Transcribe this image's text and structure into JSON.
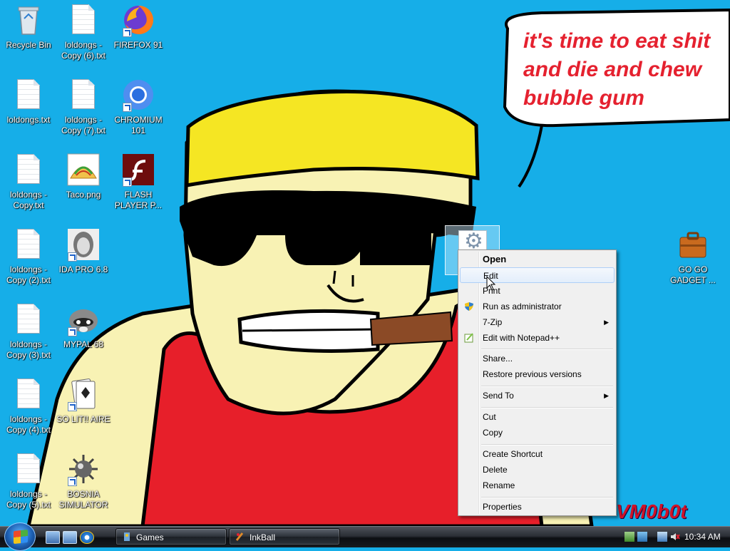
{
  "desktop": {
    "icons": [
      {
        "label": "Recycle Bin",
        "icon": "recycle-bin-icon"
      },
      {
        "label": "loldongs - Copy (6).txt",
        "icon": "text-file-icon"
      },
      {
        "label": "FIREFOX 91",
        "icon": "firefox-icon"
      },
      {
        "label": "loldongs.txt",
        "icon": "text-file-icon"
      },
      {
        "label": "loldongs - Copy (7).txt",
        "icon": "text-file-icon"
      },
      {
        "label": "CHROMIUM 101",
        "icon": "chromium-icon"
      },
      {
        "label": "loldongs - Copy.txt",
        "icon": "text-file-icon"
      },
      {
        "label": "Taco.png",
        "icon": "taco-image-icon"
      },
      {
        "label": "FLASH PLAYER P...",
        "icon": "flash-player-icon"
      },
      {
        "label": "loldongs - Copy (2).txt",
        "icon": "text-file-icon"
      },
      {
        "label": "IDA PRO 6.8",
        "icon": "ida-pro-icon"
      },
      {
        "label": "loldongs - Copy (3).txt",
        "icon": "text-file-icon"
      },
      {
        "label": "MYPAL 68",
        "icon": "mypal-raccoon-icon"
      },
      {
        "label": "loldongs - Copy (4).txt",
        "icon": "text-file-icon"
      },
      {
        "label": "SO LIT!! AIRE",
        "icon": "solitaire-icon"
      },
      {
        "label": "loldongs - Copy (5).txt",
        "icon": "text-file-icon"
      },
      {
        "label": "BOSNIA SIMULATOR",
        "icon": "minesweeper-mine-icon"
      },
      {
        "label": "GO GO GADGET ...",
        "icon": "briefcase-icon"
      }
    ],
    "speech_bubble_text": "it's time to eat shit\nand die and chew\nbubble gum",
    "watermark": "VM0b0t"
  },
  "context_menu": {
    "items": [
      {
        "label": "Open",
        "bold": true
      },
      {
        "label": "Edit",
        "highlighted": true
      },
      {
        "label": "Print"
      },
      {
        "label": "Run as administrator",
        "icon": "uac-shield-icon"
      },
      {
        "label": "7-Zip",
        "submenu": true
      },
      {
        "label": "Edit with Notepad++",
        "icon": "notepad-plus-plus-icon"
      },
      {
        "label": "Share..."
      },
      {
        "label": "Restore previous versions"
      },
      {
        "label": "Send To",
        "submenu": true
      },
      {
        "label": "Cut"
      },
      {
        "label": "Copy"
      },
      {
        "label": "Create Shortcut"
      },
      {
        "label": "Delete"
      },
      {
        "label": "Rename"
      },
      {
        "label": "Properties"
      }
    ]
  },
  "taskbar": {
    "tasks": [
      {
        "label": "Games",
        "icon": "games-icon"
      },
      {
        "label": "InkBall",
        "icon": "inkball-icon"
      }
    ],
    "clock": "10:34 AM"
  },
  "colors": {
    "desktop_bg": "#16aee8",
    "menu_bg": "#f0f0f0",
    "speech_text": "#e5212f"
  }
}
